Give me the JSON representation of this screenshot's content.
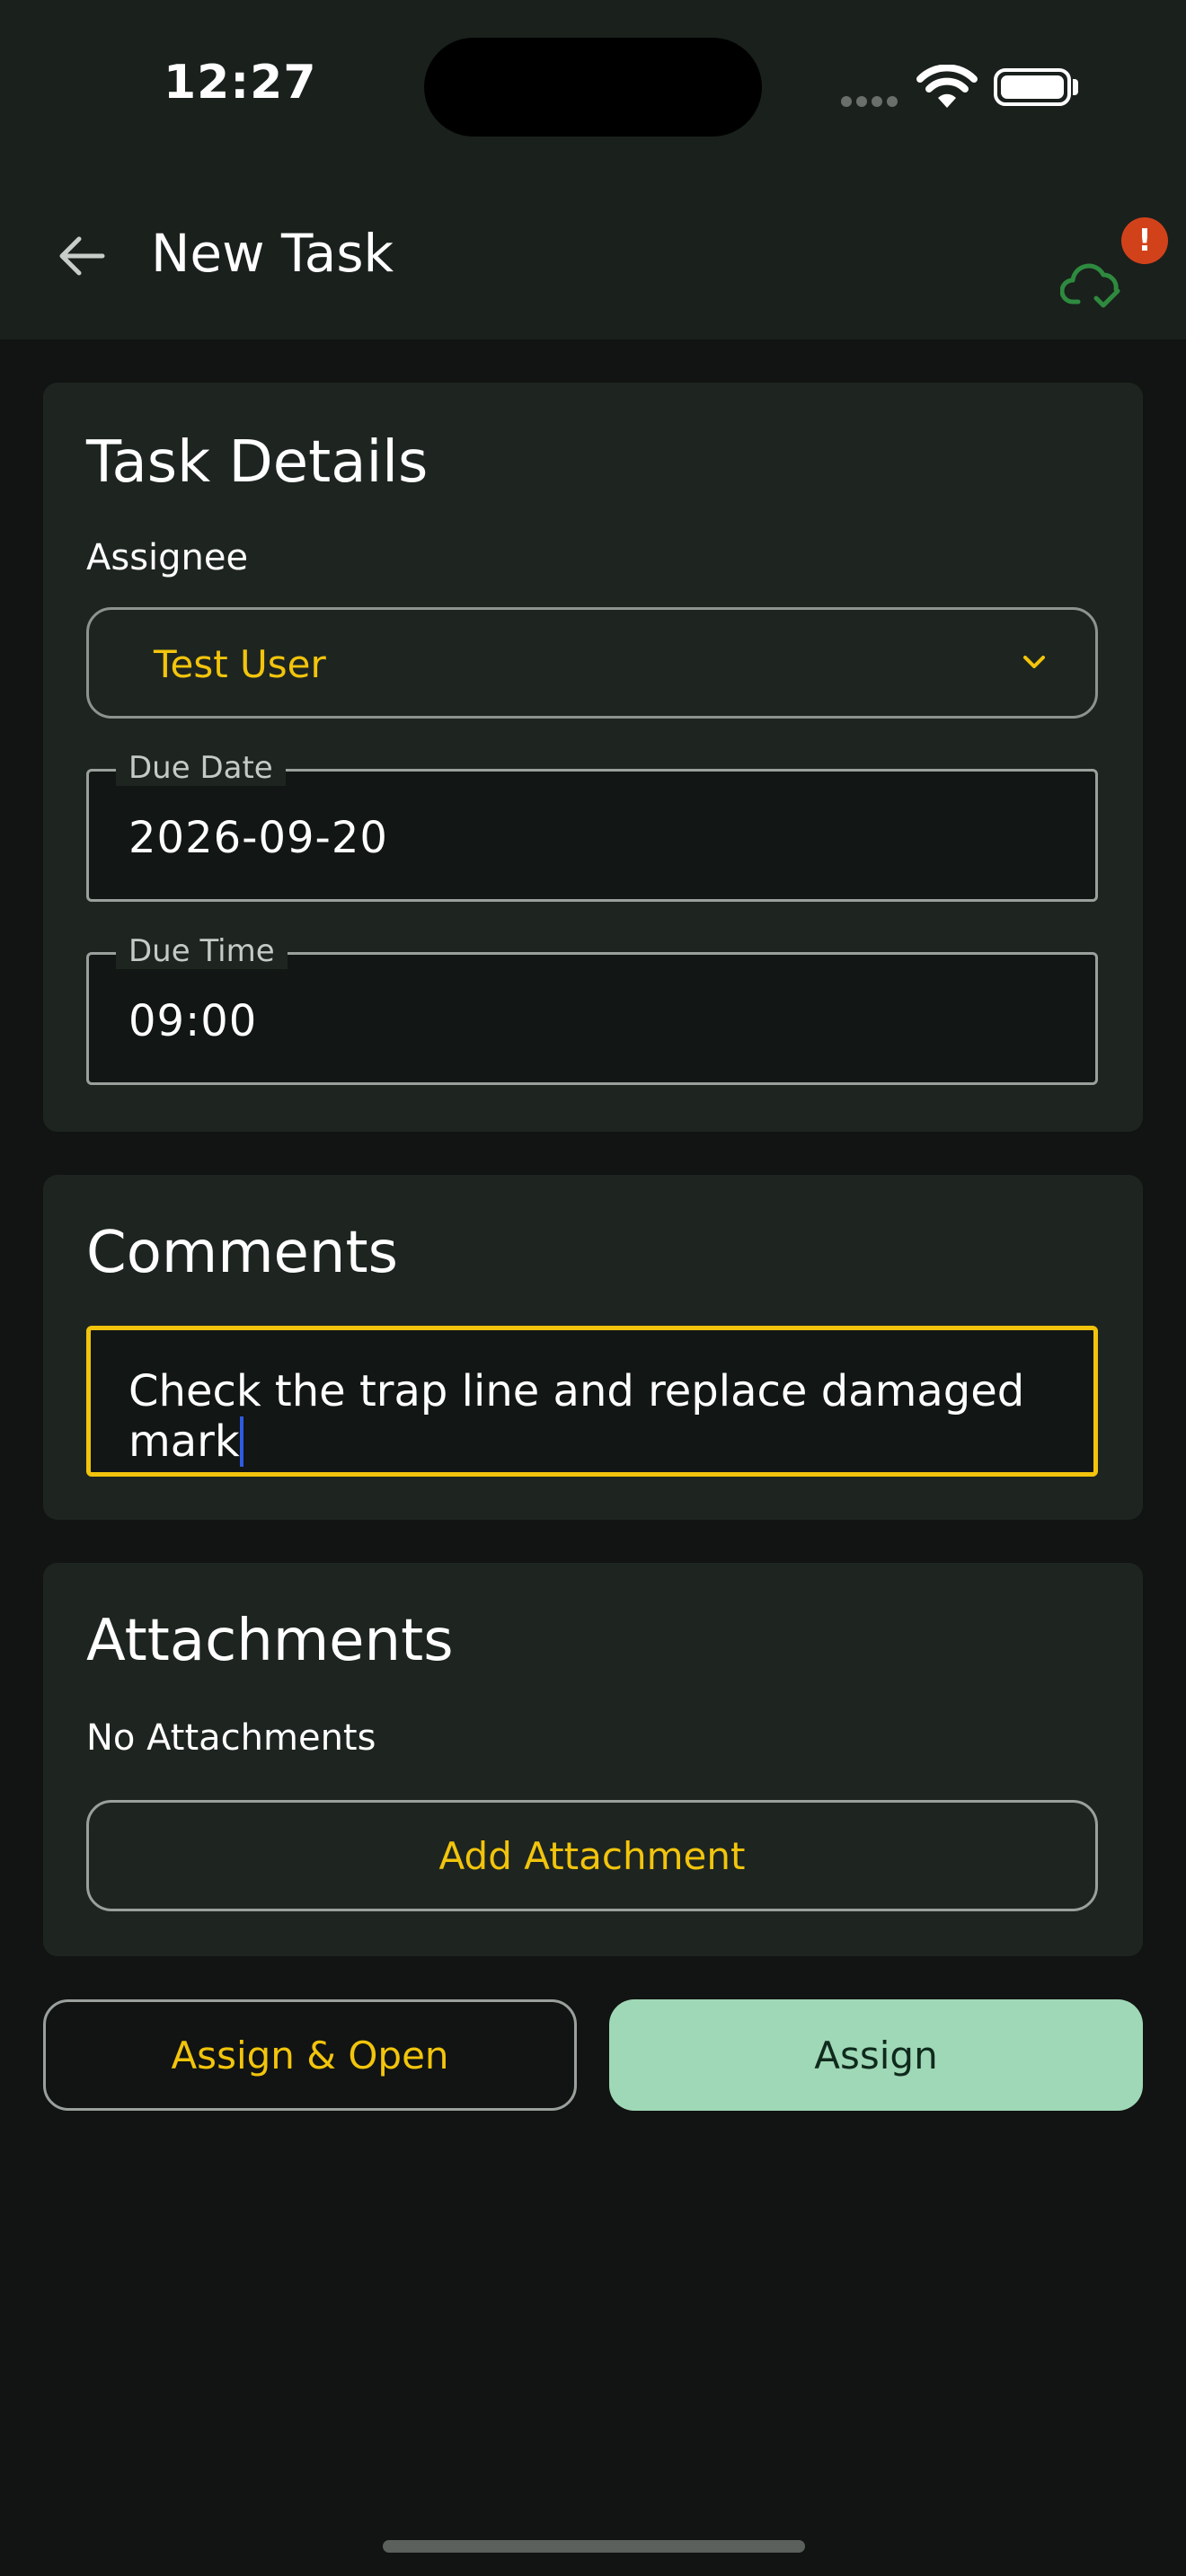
{
  "status_bar": {
    "time": "12:27"
  },
  "app_bar": {
    "title": "New Task",
    "sync_badge": "!"
  },
  "task_details": {
    "title": "Task Details",
    "assignee_label": "Assignee",
    "assignee_value": "Test User",
    "due_date_label": "Due Date",
    "due_date_value": "2026-09-20",
    "due_time_label": "Due Time",
    "due_time_value": "09:00"
  },
  "comments": {
    "title": "Comments",
    "value": "Check the trap line and replace damaged mark"
  },
  "attachments": {
    "title": "Attachments",
    "empty_text": "No Attachments",
    "add_button": "Add Attachment"
  },
  "actions": {
    "assign_open": "Assign & Open",
    "assign": "Assign"
  },
  "colors": {
    "accent_yellow": "#f2c40c",
    "primary_green": "#9fd8b6",
    "badge_red": "#d2421a",
    "cloud_green": "#2e8a3e"
  }
}
